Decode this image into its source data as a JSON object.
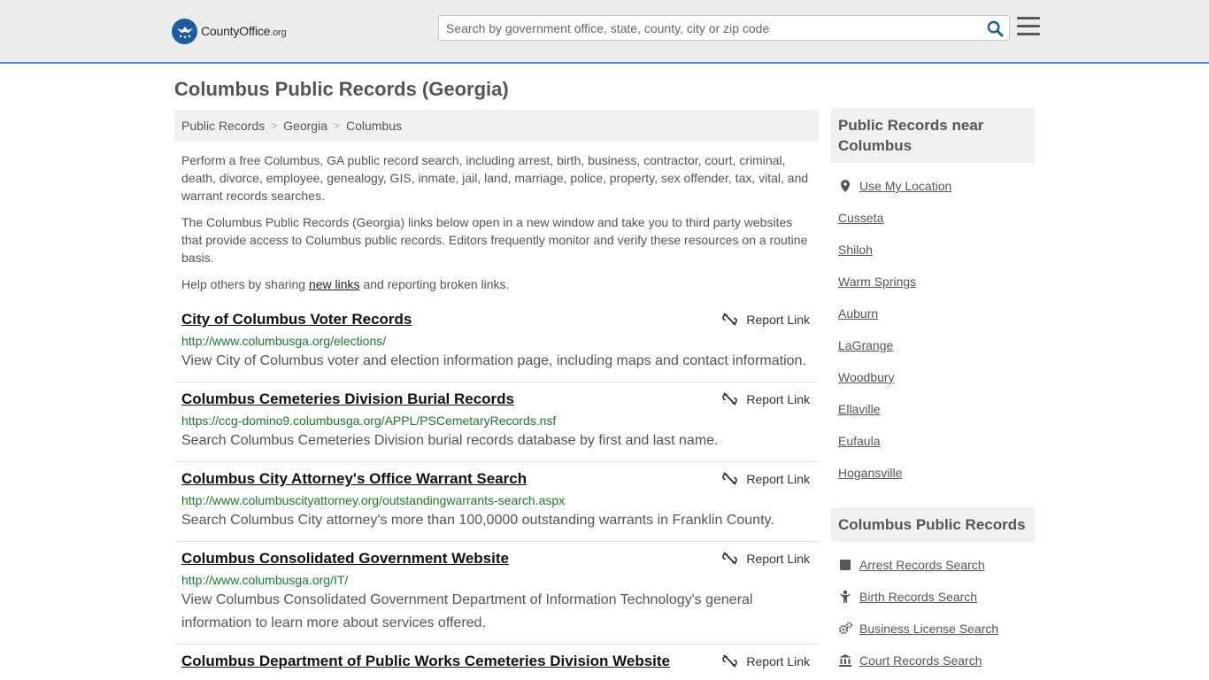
{
  "header": {
    "logo_brand": "CountyOffice",
    "logo_tld": ".org",
    "search_placeholder": "Search by government office, state, county, city or zip code"
  },
  "page_title": "Columbus Public Records (Georgia)",
  "breadcrumb": [
    "Public Records",
    "Georgia",
    "Columbus"
  ],
  "intro": {
    "p1": "Perform a free Columbus, GA public record search, including arrest, birth, business, contractor, court, criminal, death, divorce, employee, genealogy, GIS, inmate, jail, land, marriage, police, property, sex offender, tax, vital, and warrant records searches.",
    "p2": "The Columbus Public Records (Georgia) links below open in a new window and take you to third party websites that provide access to Columbus public records. Editors frequently monitor and verify these resources on a routine basis.",
    "p3_before": "Help others by sharing ",
    "p3_link": "new links",
    "p3_after": " and reporting broken links."
  },
  "report_label": "Report Link",
  "records": [
    {
      "title": "City of Columbus Voter Records",
      "url": "http://www.columbusga.org/elections/",
      "desc": "View City of Columbus voter and election information page, including maps and contact information."
    },
    {
      "title": "Columbus Cemeteries Division Burial Records",
      "url": "https://ccg-domino9.columbusga.org/APPL/PSCemetaryRecords.nsf",
      "desc": "Search Columbus Cemeteries Division burial records database by first and last name."
    },
    {
      "title": "Columbus City Attorney's Office Warrant Search",
      "url": "http://www.columbuscityattorney.org/outstandingwarrants-search.aspx",
      "desc": "Search Columbus City attorney's more than 100,0000 outstanding warrants in Franklin County."
    },
    {
      "title": "Columbus Consolidated Government Website",
      "url": "http://www.columbusga.org/IT/",
      "desc": "View Columbus Consolidated Government Department of Information Technology's general information to learn more about services offered."
    },
    {
      "title": "Columbus Department of Public Works Cemeteries Division Website",
      "url": "",
      "desc": ""
    }
  ],
  "sidebar": {
    "near_heading": "Public Records near Columbus",
    "use_location": "Use My Location",
    "near_cities": [
      "Cusseta",
      "Shiloh",
      "Warm Springs",
      "Auburn",
      "LaGrange",
      "Woodbury",
      "Ellaville",
      "Eufaula",
      "Hogansville"
    ],
    "records_heading": "Columbus Public Records",
    "record_links": [
      {
        "label": "Arrest Records Search",
        "icon": "square-icon"
      },
      {
        "label": "Birth Records Search",
        "icon": "baby-icon"
      },
      {
        "label": "Business License Search",
        "icon": "gears-icon"
      },
      {
        "label": "Court Records Search",
        "icon": "courthouse-icon"
      }
    ]
  },
  "colors": {
    "header_bg": "#ececec",
    "header_border": "#5a8fc7",
    "brand_blue": "#1f5c9e",
    "url_green": "#1c7a2d",
    "text_gray": "#555555"
  }
}
